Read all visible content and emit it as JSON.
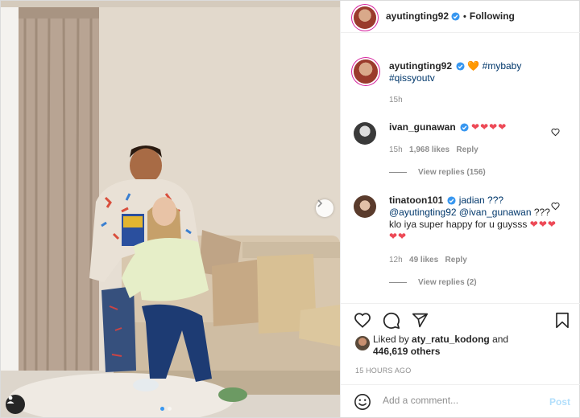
{
  "colors": {
    "accent": "#3897f0",
    "heart_red": "#ed4956",
    "hashtag": "#00376b",
    "muted": "#8e8e8e",
    "post_disabled": "#b2dffc"
  },
  "photo": {
    "carousel_index": 1,
    "carousel_total": 2
  },
  "header": {
    "username": "ayutingting92",
    "separator": "•",
    "follow_status": "Following"
  },
  "caption": {
    "username": "ayutingting92",
    "emoji": "🧡",
    "tags": [
      "#mybaby",
      "#qissyoutv"
    ],
    "time": "15h"
  },
  "comments": [
    {
      "username": "ivan_gunawan",
      "text": "",
      "hearts": "❤❤❤❤",
      "time": "15h",
      "likes": "1,968 likes",
      "reply_label": "Reply",
      "view_replies": "View replies (156)"
    },
    {
      "username": "tinatoon101",
      "text_before": "jadian ???",
      "mention_1": "@ayutingting92",
      "mention_2": "@ivan_gunawan",
      "text_after": "??? klo iya super happy for u guysss",
      "hearts": "❤❤❤❤❤",
      "time": "12h",
      "likes": "49 likes",
      "reply_label": "Reply",
      "view_replies": "View replies (2)"
    }
  ],
  "likes": {
    "prefix": "Liked by",
    "user": "aty_ratu_kodong",
    "connector": "and",
    "others": "446,619 others"
  },
  "timestamp": "15 HOURS AGO",
  "composer": {
    "placeholder": "Add a comment...",
    "post_label": "Post"
  },
  "icons": [
    "verified-badge-icon",
    "heart-icon",
    "comment-icon",
    "share-icon",
    "bookmark-icon",
    "emoji-icon",
    "chevron-right-icon",
    "user-tag-icon"
  ]
}
